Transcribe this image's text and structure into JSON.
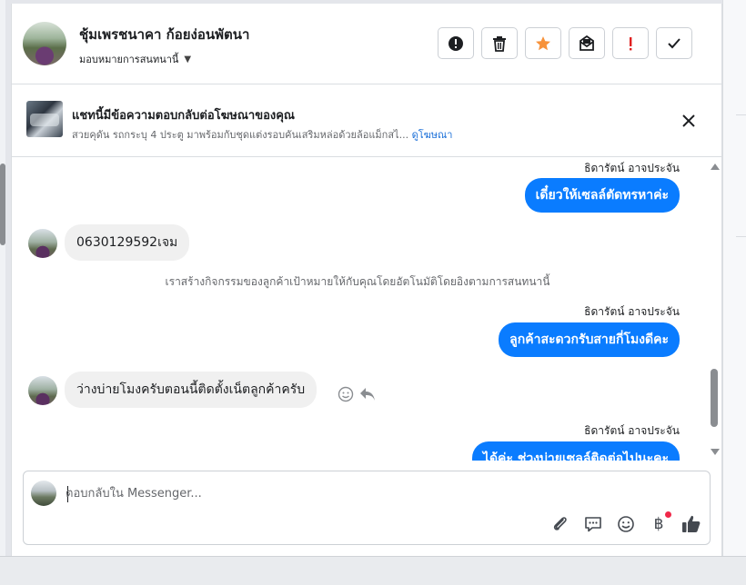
{
  "header": {
    "contact_name": "ชุ้มเพรชนาคา ก้อยง่อนพัตนา",
    "assign_label": "มอบหมายการสนทนานี้",
    "actions": [
      {
        "name": "spam-button",
        "icon": "alert-circle-icon"
      },
      {
        "name": "delete-button",
        "icon": "trash-icon"
      },
      {
        "name": "star-button",
        "icon": "star-icon"
      },
      {
        "name": "mark-unread-button",
        "icon": "envelope-icon"
      },
      {
        "name": "follow-up-button",
        "icon": "exclamation-icon"
      },
      {
        "name": "mark-done-button",
        "icon": "check-icon"
      }
    ]
  },
  "banner": {
    "title": "แชทนี้มีข้อความตอบกลับต่อโฆษณาของคุณ",
    "subtitle": "สวยคุดัน รถกระบุ 4 ประตู มาพร้อมกับชุดแต่งรอบคันเสริมหล่อด้วยล้อแม็กสไ...",
    "link": "ดูโฆษณา"
  },
  "messages": {
    "m1_sender": "ธิดารัตน์ อาจประจัน",
    "m1_text": "เดี๋ยวให้เซลล์ตัดทรหาค่ะ",
    "m2_text": "0630129592เจม",
    "system_text": "เราสร้างกิจกรรมของลูกค้าเป้าหมายให้กับคุณโดยอัตโนมัติโดยอิงตามการสนทนานี้",
    "m3_sender": "ธิดารัตน์ อาจประจัน",
    "m3_text": "ลูกค้าสะดวกรับสายกี่โมงดีคะ",
    "m4_text": "ว่างบ่ายโมงครับตอนนี้ติดตั้งเน็ตลูกค้าครับ",
    "m5_sender": "ธิดารัตน์ อาจประจัน",
    "m5_text": "ได้ค่ะ ช่วงบ่ายเซลล์ติดต่อไปนะคะ"
  },
  "composer": {
    "placeholder": "ตอบกลับใน Messenger...",
    "currency_symbol": "฿"
  },
  "colors": {
    "outgoing_bubble": "#0a7cff",
    "incoming_bubble": "#f0f0f0",
    "link": "#1a6fd8",
    "star": "#f7923b",
    "follow_up": "#e02020",
    "notification_dot": "#f02849"
  }
}
